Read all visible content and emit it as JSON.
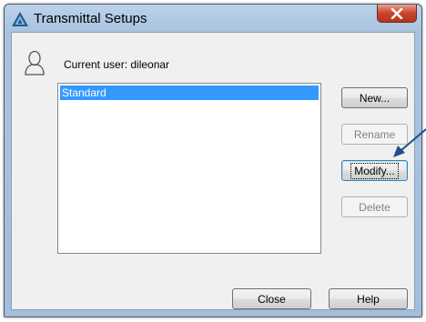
{
  "window": {
    "title": "Transmittal Setups",
    "close_symbol": "X"
  },
  "user": {
    "label": "Current user: dileonar"
  },
  "setups": {
    "items": [
      "Standard"
    ],
    "selected_index": 0
  },
  "buttons": {
    "new": "New...",
    "rename": "Rename",
    "modify": "Modify...",
    "delete": "Delete",
    "close": "Close",
    "help": "Help"
  },
  "icons": {
    "app": "autocad-a-icon",
    "user": "user-silhouette-icon",
    "close": "close-icon",
    "annotation": "arrow-pointer-icon"
  },
  "colors": {
    "selection": "#3399ff",
    "close_button": "#c7442c",
    "arrow": "#1f4e8c"
  }
}
